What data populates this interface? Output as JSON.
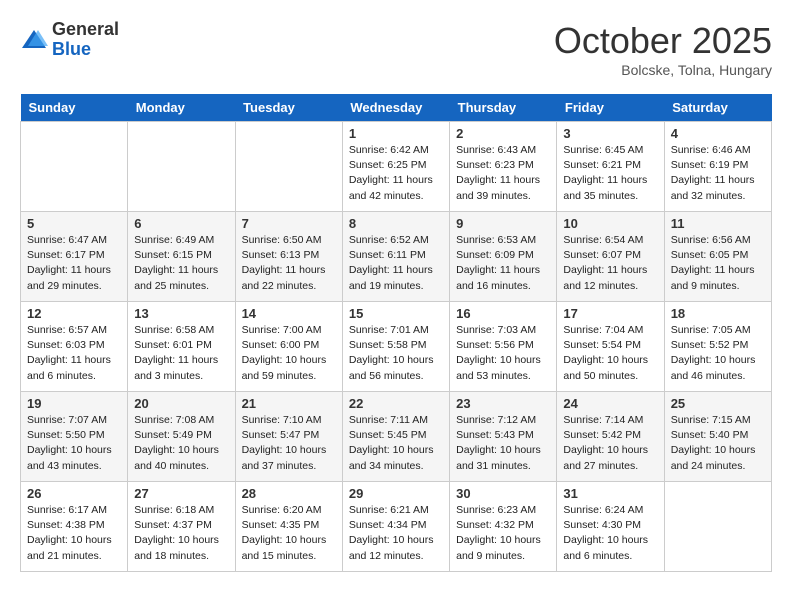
{
  "logo": {
    "general": "General",
    "blue": "Blue"
  },
  "title": "October 2025",
  "location": "Bolcske, Tolna, Hungary",
  "days_header": [
    "Sunday",
    "Monday",
    "Tuesday",
    "Wednesday",
    "Thursday",
    "Friday",
    "Saturday"
  ],
  "weeks": [
    [
      {
        "day": "",
        "info": ""
      },
      {
        "day": "",
        "info": ""
      },
      {
        "day": "",
        "info": ""
      },
      {
        "day": "1",
        "info": "Sunrise: 6:42 AM\nSunset: 6:25 PM\nDaylight: 11 hours\nand 42 minutes."
      },
      {
        "day": "2",
        "info": "Sunrise: 6:43 AM\nSunset: 6:23 PM\nDaylight: 11 hours\nand 39 minutes."
      },
      {
        "day": "3",
        "info": "Sunrise: 6:45 AM\nSunset: 6:21 PM\nDaylight: 11 hours\nand 35 minutes."
      },
      {
        "day": "4",
        "info": "Sunrise: 6:46 AM\nSunset: 6:19 PM\nDaylight: 11 hours\nand 32 minutes."
      }
    ],
    [
      {
        "day": "5",
        "info": "Sunrise: 6:47 AM\nSunset: 6:17 PM\nDaylight: 11 hours\nand 29 minutes."
      },
      {
        "day": "6",
        "info": "Sunrise: 6:49 AM\nSunset: 6:15 PM\nDaylight: 11 hours\nand 25 minutes."
      },
      {
        "day": "7",
        "info": "Sunrise: 6:50 AM\nSunset: 6:13 PM\nDaylight: 11 hours\nand 22 minutes."
      },
      {
        "day": "8",
        "info": "Sunrise: 6:52 AM\nSunset: 6:11 PM\nDaylight: 11 hours\nand 19 minutes."
      },
      {
        "day": "9",
        "info": "Sunrise: 6:53 AM\nSunset: 6:09 PM\nDaylight: 11 hours\nand 16 minutes."
      },
      {
        "day": "10",
        "info": "Sunrise: 6:54 AM\nSunset: 6:07 PM\nDaylight: 11 hours\nand 12 minutes."
      },
      {
        "day": "11",
        "info": "Sunrise: 6:56 AM\nSunset: 6:05 PM\nDaylight: 11 hours\nand 9 minutes."
      }
    ],
    [
      {
        "day": "12",
        "info": "Sunrise: 6:57 AM\nSunset: 6:03 PM\nDaylight: 11 hours\nand 6 minutes."
      },
      {
        "day": "13",
        "info": "Sunrise: 6:58 AM\nSunset: 6:01 PM\nDaylight: 11 hours\nand 3 minutes."
      },
      {
        "day": "14",
        "info": "Sunrise: 7:00 AM\nSunset: 6:00 PM\nDaylight: 10 hours\nand 59 minutes."
      },
      {
        "day": "15",
        "info": "Sunrise: 7:01 AM\nSunset: 5:58 PM\nDaylight: 10 hours\nand 56 minutes."
      },
      {
        "day": "16",
        "info": "Sunrise: 7:03 AM\nSunset: 5:56 PM\nDaylight: 10 hours\nand 53 minutes."
      },
      {
        "day": "17",
        "info": "Sunrise: 7:04 AM\nSunset: 5:54 PM\nDaylight: 10 hours\nand 50 minutes."
      },
      {
        "day": "18",
        "info": "Sunrise: 7:05 AM\nSunset: 5:52 PM\nDaylight: 10 hours\nand 46 minutes."
      }
    ],
    [
      {
        "day": "19",
        "info": "Sunrise: 7:07 AM\nSunset: 5:50 PM\nDaylight: 10 hours\nand 43 minutes."
      },
      {
        "day": "20",
        "info": "Sunrise: 7:08 AM\nSunset: 5:49 PM\nDaylight: 10 hours\nand 40 minutes."
      },
      {
        "day": "21",
        "info": "Sunrise: 7:10 AM\nSunset: 5:47 PM\nDaylight: 10 hours\nand 37 minutes."
      },
      {
        "day": "22",
        "info": "Sunrise: 7:11 AM\nSunset: 5:45 PM\nDaylight: 10 hours\nand 34 minutes."
      },
      {
        "day": "23",
        "info": "Sunrise: 7:12 AM\nSunset: 5:43 PM\nDaylight: 10 hours\nand 31 minutes."
      },
      {
        "day": "24",
        "info": "Sunrise: 7:14 AM\nSunset: 5:42 PM\nDaylight: 10 hours\nand 27 minutes."
      },
      {
        "day": "25",
        "info": "Sunrise: 7:15 AM\nSunset: 5:40 PM\nDaylight: 10 hours\nand 24 minutes."
      }
    ],
    [
      {
        "day": "26",
        "info": "Sunrise: 6:17 AM\nSunset: 4:38 PM\nDaylight: 10 hours\nand 21 minutes."
      },
      {
        "day": "27",
        "info": "Sunrise: 6:18 AM\nSunset: 4:37 PM\nDaylight: 10 hours\nand 18 minutes."
      },
      {
        "day": "28",
        "info": "Sunrise: 6:20 AM\nSunset: 4:35 PM\nDaylight: 10 hours\nand 15 minutes."
      },
      {
        "day": "29",
        "info": "Sunrise: 6:21 AM\nSunset: 4:34 PM\nDaylight: 10 hours\nand 12 minutes."
      },
      {
        "day": "30",
        "info": "Sunrise: 6:23 AM\nSunset: 4:32 PM\nDaylight: 10 hours\nand 9 minutes."
      },
      {
        "day": "31",
        "info": "Sunrise: 6:24 AM\nSunset: 4:30 PM\nDaylight: 10 hours\nand 6 minutes."
      },
      {
        "day": "",
        "info": ""
      }
    ]
  ]
}
